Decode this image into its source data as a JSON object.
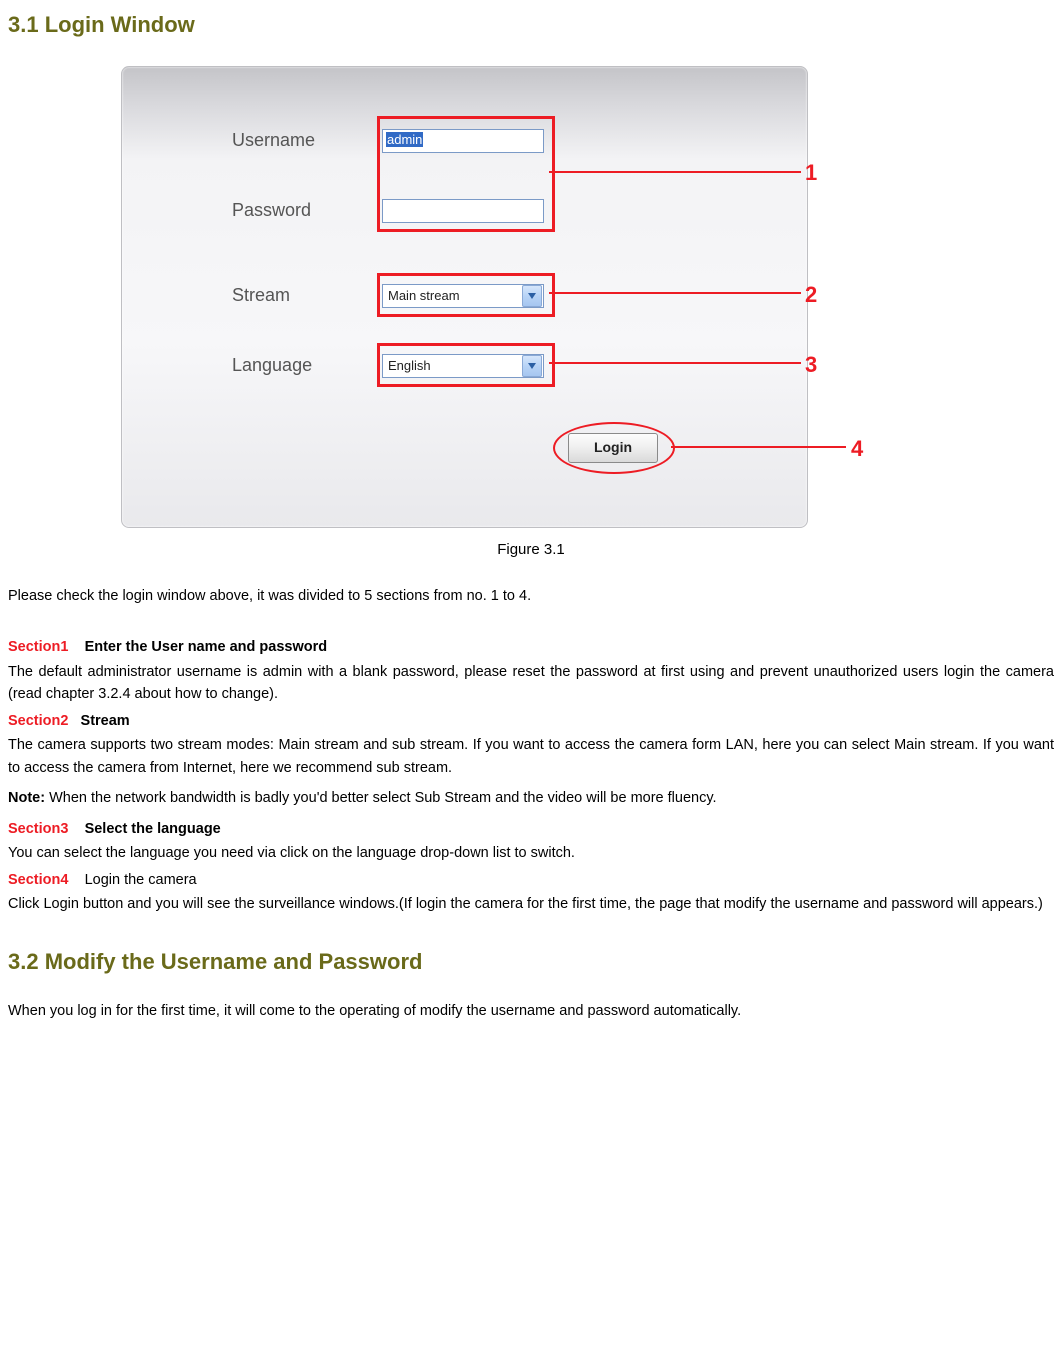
{
  "heading1": "3.1    Login Window",
  "figure": {
    "labels": {
      "username": "Username",
      "password": "Password",
      "stream": "Stream",
      "language": "Language"
    },
    "values": {
      "username": "admin",
      "stream": "Main stream",
      "language": "English"
    },
    "login_btn": "Login",
    "callouts": {
      "c1": "1",
      "c2": "2",
      "c3": "3",
      "c4": "4"
    },
    "caption": "Figure 3.1"
  },
  "intro": "Please check the login window above, it was divided to 5 sections from no. 1 to 4.",
  "sec1": {
    "tag": "Section1",
    "title": "Enter the User name and password"
  },
  "sec1_body": "The default administrator username is admin with a blank password, please reset the password at first using and prevent unauthorized users login the camera (read chapter 3.2.4 about how to change).",
  "sec2": {
    "tag": "Section2",
    "title": "Stream"
  },
  "sec2_body": "The camera supports two stream modes: Main stream and sub stream. If you want to access the camera form LAN, here you can select Main stream. If you want to access the camera from Internet, here we recommend sub stream.",
  "note_label": "Note:",
  "note_body": " When the network bandwidth is badly you'd better select Sub Stream and the video will be more fluency.",
  "sec3": {
    "tag": "Section3",
    "title": "Select the language"
  },
  "sec3_body": "You can select the language you need via click on the language drop-down list to switch.",
  "sec4": {
    "tag": "Section4",
    "title": "Login the camera"
  },
  "sec4_body": "Click Login button and you will see the surveillance windows.(If login the camera for the first time, the page that modify the username and password will appears.)",
  "heading2": "3.2    Modify the Username and Password",
  "body2": "When you log in for the first time, it will come to the operating of modify the username and password automatically."
}
